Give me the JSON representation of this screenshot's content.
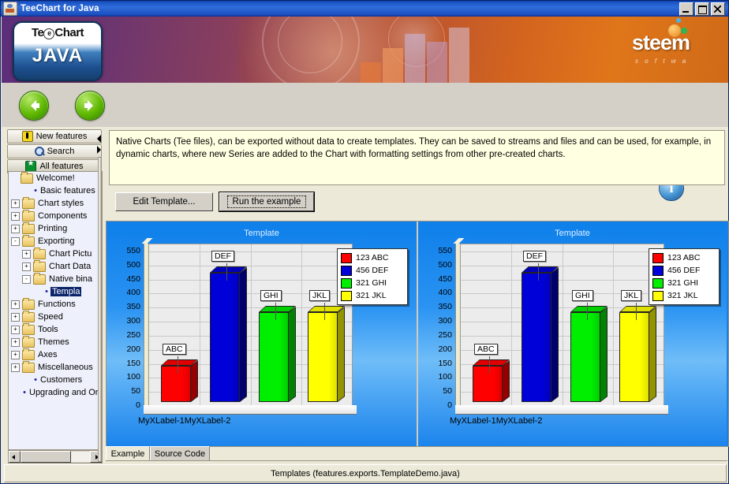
{
  "window": {
    "title": "TeeChart for Java",
    "icon": "java-cup-icon",
    "minimize_label": "Minimize",
    "maximize_label": "Maximize",
    "close_label": "Close"
  },
  "banner": {
    "logo_line1": "TeChart",
    "logo_e": "e",
    "logo_line2": "JAVA",
    "brand": "steem",
    "brand_sub": "s o f t w a"
  },
  "toolbar": {
    "back_label": "Back",
    "forward_label": "Forward",
    "info_label": "i"
  },
  "nav_tabs": [
    {
      "label": "New features",
      "icon": "new-features-icon",
      "selected": false
    },
    {
      "label": "Search",
      "icon": "search-icon",
      "selected": false
    },
    {
      "label": "All features",
      "icon": "all-features-icon",
      "selected": true
    }
  ],
  "tree": [
    {
      "label": "Welcome!",
      "indent": 0,
      "toggle": "",
      "icon": "folder",
      "selected": false
    },
    {
      "label": "Basic features",
      "indent": 1,
      "toggle": "",
      "icon": "bullet",
      "selected": false
    },
    {
      "label": "Chart styles",
      "indent": 0,
      "toggle": "+",
      "icon": "folder",
      "selected": false
    },
    {
      "label": "Components",
      "indent": 0,
      "toggle": "+",
      "icon": "folder",
      "selected": false
    },
    {
      "label": "Printing",
      "indent": 0,
      "toggle": "+",
      "icon": "folder",
      "selected": false
    },
    {
      "label": "Exporting",
      "indent": 0,
      "toggle": "-",
      "icon": "folder",
      "selected": false
    },
    {
      "label": "Chart Pictu",
      "indent": 1,
      "toggle": "+",
      "icon": "folder",
      "selected": false
    },
    {
      "label": "Chart Data",
      "indent": 1,
      "toggle": "+",
      "icon": "folder",
      "selected": false
    },
    {
      "label": "Native bina",
      "indent": 1,
      "toggle": "-",
      "icon": "folder",
      "selected": false
    },
    {
      "label": "Templa",
      "indent": 2,
      "toggle": "",
      "icon": "bullet",
      "selected": true
    },
    {
      "label": "Functions",
      "indent": 0,
      "toggle": "+",
      "icon": "folder",
      "selected": false
    },
    {
      "label": "Speed",
      "indent": 0,
      "toggle": "+",
      "icon": "folder",
      "selected": false
    },
    {
      "label": "Tools",
      "indent": 0,
      "toggle": "+",
      "icon": "folder",
      "selected": false
    },
    {
      "label": "Themes",
      "indent": 0,
      "toggle": "+",
      "icon": "folder",
      "selected": false
    },
    {
      "label": "Axes",
      "indent": 0,
      "toggle": "+",
      "icon": "folder",
      "selected": false
    },
    {
      "label": "Miscellaneous",
      "indent": 0,
      "toggle": "+",
      "icon": "folder",
      "selected": false
    },
    {
      "label": "Customers",
      "indent": 1,
      "toggle": "",
      "icon": "bullet",
      "selected": false
    },
    {
      "label": "Upgrading and Ord",
      "indent": 0,
      "toggle": "",
      "icon": "bullet",
      "selected": false
    }
  ],
  "description": "Native Charts (Tee files), can be exported without data to create templates. They can be saved to streams and files and can be used, for example, in dynamic charts, where new Series are added to the Chart with formatting settings from other pre-created charts.",
  "buttons": {
    "edit_template": "Edit Template...",
    "run_example": "Run the example"
  },
  "bottom_tabs": [
    {
      "label": "Example",
      "selected": true
    },
    {
      "label": "Source Code",
      "selected": false
    }
  ],
  "status_bar": "Templates  (features.exports.TemplateDemo.java)",
  "chart_data": [
    {
      "type": "bar",
      "title": "Template",
      "xlabel": "",
      "ylabel": "",
      "categories": [
        "ABC",
        "DEF",
        "GHI",
        "JKL"
      ],
      "values": [
        130,
        460,
        320,
        320
      ],
      "colors": [
        "#ff0000",
        "#0000d8",
        "#00ee00",
        "#ffff00"
      ],
      "point_labels": [
        "ABC",
        "DEF",
        "GHI",
        "JKL"
      ],
      "ylim": [
        0,
        575
      ],
      "yticks": [
        0,
        50,
        100,
        150,
        200,
        250,
        300,
        350,
        400,
        450,
        500,
        550
      ],
      "xticklabels": [
        "MyXLabel-1",
        "MyXLabel-2"
      ],
      "grid": true,
      "legend_position": "right",
      "legend": [
        {
          "label": "123 ABC",
          "color": "#ff0000"
        },
        {
          "label": "456 DEF",
          "color": "#0000d8"
        },
        {
          "label": "321 GHI",
          "color": "#00ee00"
        },
        {
          "label": "321 JKL",
          "color": "#ffff00"
        }
      ]
    },
    {
      "type": "bar",
      "title": "Template",
      "xlabel": "",
      "ylabel": "",
      "categories": [
        "ABC",
        "DEF",
        "GHI",
        "JKL"
      ],
      "values": [
        130,
        460,
        320,
        320
      ],
      "colors": [
        "#ff0000",
        "#0000d8",
        "#00ee00",
        "#ffff00"
      ],
      "point_labels": [
        "ABC",
        "DEF",
        "GHI",
        "JKL"
      ],
      "ylim": [
        0,
        575
      ],
      "yticks": [
        0,
        50,
        100,
        150,
        200,
        250,
        300,
        350,
        400,
        450,
        500,
        550
      ],
      "xticklabels": [
        "MyXLabel-1",
        "MyXLabel-2"
      ],
      "grid": true,
      "legend_position": "right",
      "legend": [
        {
          "label": "123 ABC",
          "color": "#ff0000"
        },
        {
          "label": "456 DEF",
          "color": "#0000d8"
        },
        {
          "label": "321 GHI",
          "color": "#00ee00"
        },
        {
          "label": "321 JKL",
          "color": "#ffff00"
        }
      ]
    }
  ]
}
